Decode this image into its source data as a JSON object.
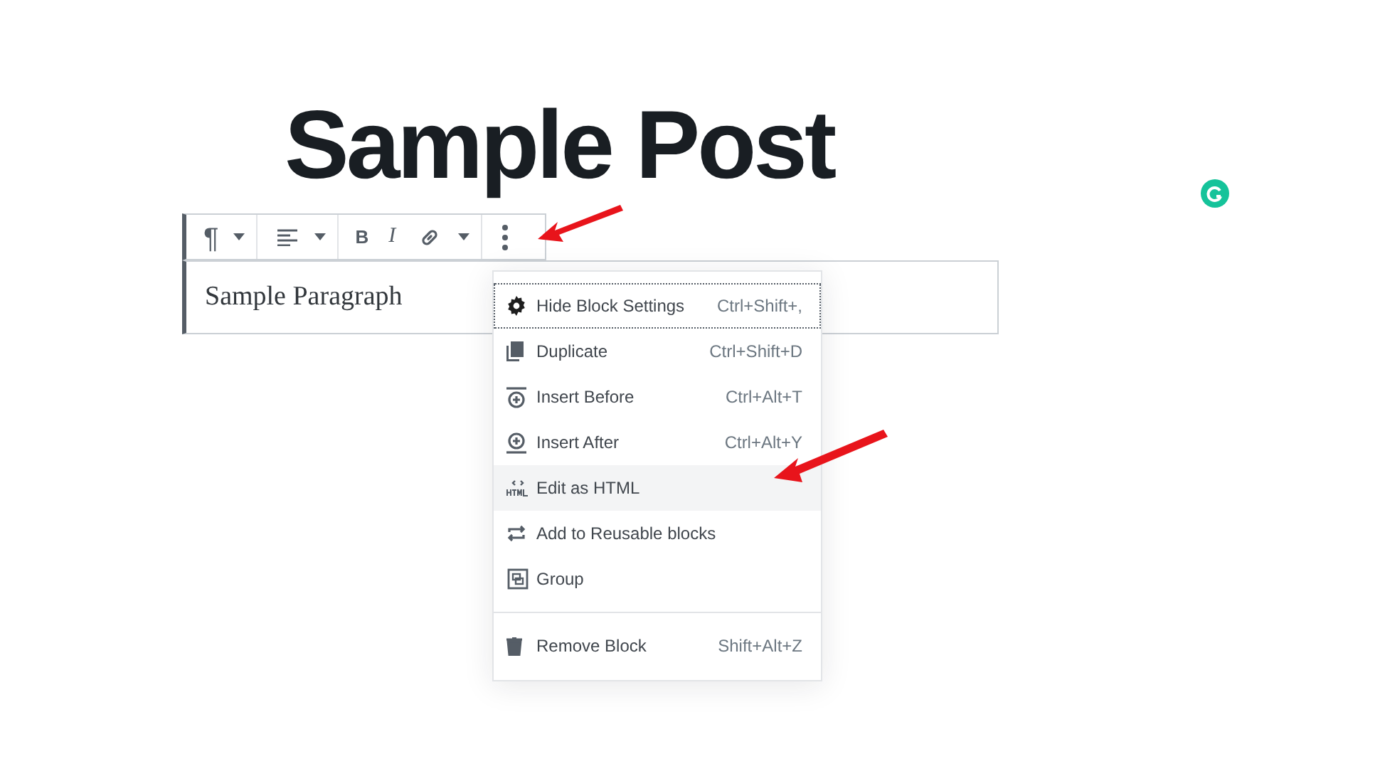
{
  "post_title": "Sample Post",
  "toolbar": {
    "groups": [
      [
        {
          "kind": "paragraph",
          "text": "¶"
        },
        {
          "kind": "caret"
        }
      ],
      [
        {
          "kind": "align"
        },
        {
          "kind": "caret"
        }
      ],
      [
        {
          "kind": "bold",
          "text": "B"
        },
        {
          "kind": "italic",
          "text": "I"
        },
        {
          "kind": "link"
        },
        {
          "kind": "caret"
        }
      ],
      [
        {
          "kind": "more"
        }
      ]
    ]
  },
  "paragraph": "Sample Paragraph",
  "menu": {
    "groups": [
      [
        {
          "kind": "gear",
          "label": "Hide Block Settings",
          "shortcut": "Ctrl+Shift+,",
          "focused": true,
          "selected": false
        },
        {
          "kind": "copy",
          "label": "Duplicate",
          "shortcut": "Ctrl+Shift+D",
          "focused": false,
          "selected": false
        },
        {
          "kind": "insert-before",
          "label": "Insert Before",
          "shortcut": "Ctrl+Alt+T",
          "focused": false,
          "selected": false
        },
        {
          "kind": "insert-after",
          "label": "Insert After",
          "shortcut": "Ctrl+Alt+Y",
          "focused": false,
          "selected": false
        },
        {
          "kind": "html",
          "label": "Edit as HTML",
          "focused": false,
          "selected": true
        },
        {
          "kind": "reusable",
          "label": "Add to Reusable blocks",
          "focused": false,
          "selected": false
        },
        {
          "kind": "group",
          "label": "Group",
          "focused": false,
          "selected": false
        }
      ],
      [
        {
          "kind": "trash",
          "label": "Remove Block",
          "shortcut": "Shift+Alt+Z",
          "focused": false,
          "selected": false
        }
      ]
    ]
  },
  "annotations": [
    {
      "kind": "arrow"
    },
    {
      "kind": "arrow"
    }
  ]
}
